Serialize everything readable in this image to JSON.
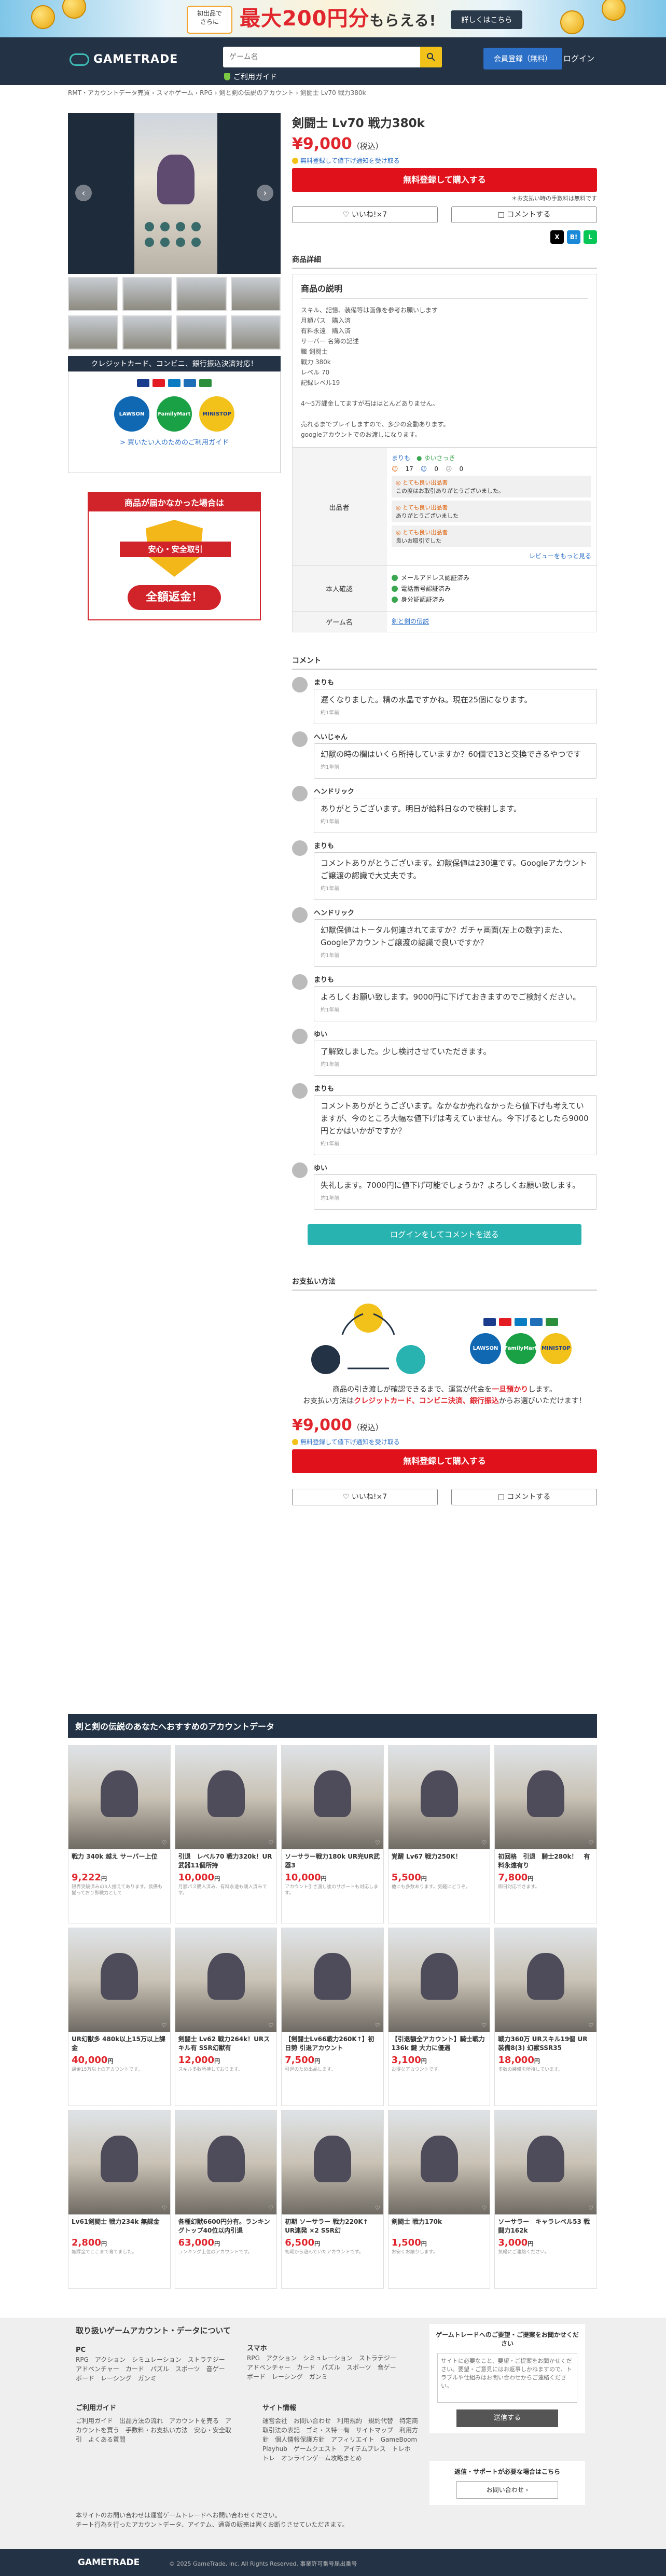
{
  "banner": {
    "small": "初出品で\nさらに",
    "big": "最大200円分",
    "big_tail": "もらえる!",
    "btn": "詳しくはこちら"
  },
  "header": {
    "logo": "GAMETRADE",
    "search_placeholder": "ゲーム名",
    "guide": "ご利用ガイド",
    "register": "会員登録（無料）",
    "login": "ログイン"
  },
  "breadcrumb": "RMT・アカウントデータ売買 › スマホゲーム › RPG › 剣と剣の伝説のアカウント › 剣闘士 Lv70 戦力380k",
  "gallery": {
    "prev": "‹",
    "next": "›"
  },
  "payment": {
    "head": "クレジットカード、コンビニ、銀行振込決済対応！",
    "c1": "LAWSON",
    "c2": "FamilyMart",
    "c3": "MINISTOP",
    "link": "> 買いたい人のためのご利用ガイド"
  },
  "safe": {
    "title": "商品が届かなかった場合は",
    "ribbon": "安心・安全取引",
    "ret": "全額返金！"
  },
  "product": {
    "title": "剣闘士 Lv70 戦力380k",
    "price": "¥9,000",
    "tax": "（税込）",
    "notice": "無料登録して値下げ通知を受け取る",
    "buy": "無料登録して購入する",
    "fee": "＊お支払い時の手数料は無料です",
    "like": "♡ いいね!×7",
    "comment": "□ コメントする"
  },
  "share": {
    "x": "X",
    "b": "B!",
    "l": "L"
  },
  "detail": {
    "sec": "商品詳細",
    "h": "商品の説明",
    "lines": [
      "スキル、記憶、装備等は画像を参考お願いします",
      "月額パス　購入済",
      "有料永遠　購入済",
      "サーバー 名簿の記述",
      "職 剣闘士",
      "戦力 380k",
      "レベル 70",
      "記録レベル19",
      "",
      "4〜5万課金してますが石ははとんどありません。",
      "",
      "売れるまでプレイしますので、多少の変動あります。",
      "googleアカウントでのお渡しになります。"
    ]
  },
  "seller": {
    "k": "出品者",
    "name": "まりも",
    "badge": "● ゆいさっき",
    "good": "17",
    "mid": "0",
    "bad": "0",
    "reviews": [
      {
        "t": "◎ とても良い出品者",
        "s": "この度はお取引ありがとうございました。"
      },
      {
        "t": "◎ とても良い出品者",
        "s": "ありがとうございました"
      },
      {
        "t": "◎ とても良い出品者",
        "s": "良いお取引でした"
      }
    ],
    "more": "レビューをもっと見る"
  },
  "verify": {
    "k": "本人確認",
    "items": [
      "メールアドレス認証済み",
      "電話番号認証済み",
      "身分証認証済み"
    ]
  },
  "gamename": {
    "k": "ゲーム名",
    "v": "剣と剣の伝説"
  },
  "comments_sec": "コメント",
  "comments": [
    {
      "n": "まりも",
      "t": "遅くなりました。精の水晶ですかね。現在25個になります。",
      "d": "約1年前"
    },
    {
      "n": "へいじゃん",
      "t": "幻獣の時の欄はいくら所持していますか？60個で13と交換できるやつです",
      "d": "約1年前"
    },
    {
      "n": "ヘンドリック",
      "t": "ありがとうございます。明日が給料日なので検討します。",
      "d": "約1年前"
    },
    {
      "n": "まりも",
      "t": "コメントありがとうございます。幻獣保値は230連です。Googleアカウントご譲渡の認識で大丈夫です。",
      "d": "約1年前"
    },
    {
      "n": "ヘンドリック",
      "t": "幻獣保値はトータル何連されてますか？ガチャ画面(左上の数字)また、Googleアカウントご譲渡の認識で良いですか？",
      "d": "約1年前"
    },
    {
      "n": "まりも",
      "t": "よろしくお願い致します。9000円に下げておきますのでご検討ください。",
      "d": "約1年前"
    },
    {
      "n": "ゆい",
      "t": "了解致しました。少し検討させていただきます。",
      "d": "約1年前"
    },
    {
      "n": "まりも",
      "t": "コメントありがとうございます。なかなか売れなかったら値下げも考えていますが、今のところ大幅な値下げは考えていません。今下げるとしたら9000円とかはいかがですか？",
      "d": "約1年前"
    },
    {
      "n": "ゆい",
      "t": "失礼します。7000円に値下げ可能でしょうか？よろしくお願い致します。",
      "d": "約1年前"
    }
  ],
  "login_comment": "ログインをしてコメントを送る",
  "paysec": {
    "h": "お支払い方法",
    "m1a": "商品の引き渡しが確認できるまで、運営が代金を",
    "m1b": "一旦預かり",
    "m1c": "します。",
    "m2a": "お支払い方法は",
    "m2b": "クレジットカード、コンビニ決済、銀行振込",
    "m2c": "からお選びいただけます！"
  },
  "rec": {
    "h": "剣と剣の伝説のあなたへおすすめのアカウントデータ",
    "items": [
      {
        "n": "戦力 340k 越え サーバー上位",
        "p": "9,222",
        "d": "限界突破済みの3人揃えてあります。装備も揃っており即戦力として"
      },
      {
        "n": "引退　レベル70 戦力320k！UR武器11個所持",
        "p": "10,000",
        "d": "月額パス購入済み、有料永遠も購入済みです。"
      },
      {
        "n": "ソーサラー戦力180k UR完UR武器3",
        "p": "10,000",
        "d": "アカウント引き渡し後のサポートも対応します。"
      },
      {
        "n": "覚醒 Lv67 戦力250K！",
        "p": "5,500",
        "d": "他にも多数あります。気軽にどうぞ。"
      },
      {
        "n": "初回格　引退　騎士280k！　有料永遠有り",
        "p": "7,800",
        "d": "即日対応できます。"
      },
      {
        "n": "UR幻獣多 480k以上15万以上課金",
        "p": "40,000",
        "d": "課金15万以上のアカウントです。"
      },
      {
        "n": "剣闘士 Lv62 戦力264k！URスキル有 SSR幻獣有",
        "p": "12,000",
        "d": "スキル多数所持しております。"
      },
      {
        "n": "【剣闘士Lv66戦力260K↑】初日勢 引退アカウント",
        "p": "7,500",
        "d": "引退のため出品します。"
      },
      {
        "n": "【引退額全アカウント】騎士戦力136k 鍵 大力に優遇",
        "p": "3,100",
        "d": "お得なアカウントです。"
      },
      {
        "n": "戦力360万 URスキル19個 UR装備8(3) 幻獣SSR35",
        "p": "18,000",
        "d": "多数の装備を所持しています。"
      },
      {
        "n": "Lv61剣闘士 戦力234k 無課金",
        "p": "2,800",
        "d": "無課金でここまで育てました。"
      },
      {
        "n": "各種幻獣6600円分有。ランキングトップ40位以内引退",
        "p": "63,000",
        "d": "ランキング上位のアカウントです。"
      },
      {
        "n": "初期 ソーサラー 戦力220K↑ UR連発 ×2 SSR幻",
        "p": "6,500",
        "d": "初期から遊んでいたアカウントです。"
      },
      {
        "n": "剣闘士 戦力170k",
        "p": "1,500",
        "d": "お安くお譲りします。"
      },
      {
        "n": "ソーサラー　キャラレベル53 戦闘力162k",
        "p": "3,000",
        "d": "気軽にご連絡ください。"
      }
    ]
  },
  "footer": {
    "title": "取り扱いゲームアカウント・データについて",
    "pc": "PC",
    "pc_list": "RPG　アクション　シミュレーション　ストラテジー　アドベンチャー　カード　パズル　スポーツ　音ゲー　ボード　レーシング　ガンミ",
    "sp": "スマホ",
    "sp_list": "RPG　アクション　シミュレーション　ストラテジー　アドベンチャー　カード　パズル　スポーツ　音ゲー　ボード　レーシング　ガンミ",
    "g1": "ご利用ガイド",
    "g1_list": "ご利用ガイド　出品方法の流れ　アカウントを売る　アカウントを買う　手数料・お支払い方法　安心・安全取引　よくある質問",
    "g2": "サイト情報",
    "g2_list": "運営会社　お問い合わせ　利用規約　規約代替　特定商取引法の表記　ゴミ・ス特ー有　サイトマップ　利用方針　個人情報保護方針　アフィリエイト　GameBoom　Playhub　ゲームクエスト　アイテムプレス　トレホ トレ　オンラインゲーム攻略まとめ",
    "box_t": "ゲームトレードへのご要望・ご提案をお聞かせください",
    "box_ph": "サイトに必要なこと、要望・ご提案をお聞かせください。要望・ご意見にはお返事しかねますので、トラブルや仕組みはお問い合わせからご連絡ください。",
    "send": "送信する",
    "box2_t": "返信・サポートが必要な場合はこちら",
    "q": "お問い合わせ ›",
    "note": "本サイトのお問い合わせは運営ゲームトレードへお問い合わせください。\nチート行為を行ったアカウントデータ、アイテム、通貨の販売は固くお断りさせていただきます。",
    "copy": "© 2025 GameTrade, inc. All Rights Reserved. 事業許可番号届出番号"
  }
}
